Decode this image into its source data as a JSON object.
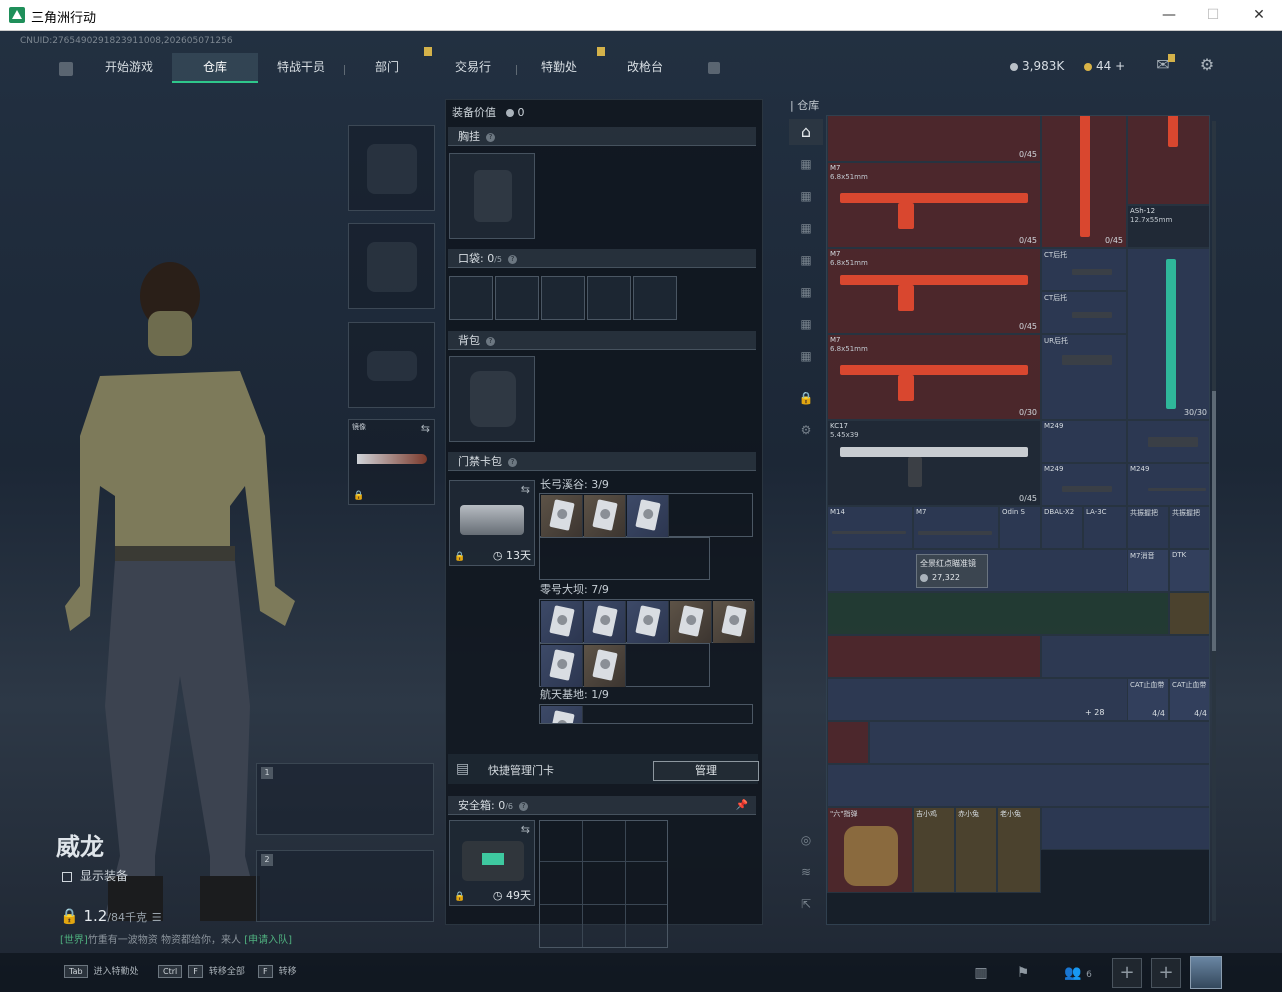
{
  "window": {
    "title": "三角洲行动",
    "min": "—",
    "max": "☐",
    "close": "✕"
  },
  "cnuid": "CNUID:2765490291823911008,202605071256",
  "nav": {
    "tabs": [
      {
        "label": "开始游戏"
      },
      {
        "label": "仓库"
      },
      {
        "label": "特战干员"
      },
      {
        "label": "部门"
      },
      {
        "label": "交易行"
      },
      {
        "label": "特勤处"
      },
      {
        "label": "改枪台"
      }
    ],
    "active_tab": "仓库"
  },
  "currency": {
    "silver": "3,983K",
    "gold": "44",
    "gold_plus": "+"
  },
  "equipment": {
    "value_label": "装备价值",
    "value": "0",
    "chest_rig": "胸挂",
    "pocket_label": "口袋:",
    "pocket_value": "0",
    "pocket_max": "/5",
    "backpack": "背包",
    "keycard_label": "门禁卡包",
    "keycard_days": "13天",
    "maps": [
      {
        "name": "长弓溪谷:",
        "count": "3/9"
      },
      {
        "name": "零号大坝:",
        "count": "7/9"
      },
      {
        "name": "航天基地:",
        "count": "1/9"
      }
    ],
    "quick_manage": "快捷管理门卡",
    "manage_btn": "管理",
    "safebox_label": "安全箱:",
    "safebox_value": "0",
    "safebox_max": "/6",
    "safebox_days": "49天"
  },
  "character": {
    "name": "威龙",
    "show_gear": "显示装备",
    "weight": "1.2",
    "weight_max": "/84千克",
    "knife_label": "镜像",
    "slot1": "1",
    "slot2": "2"
  },
  "chat": {
    "prefix": "[世界]",
    "text": "竹重有一波物资 物资都给你，来人",
    "link": "[申请入队]"
  },
  "warehouse": {
    "title": "仓库",
    "items": {
      "m7a": {
        "name": "M7",
        "sub": "6.8x51mm",
        "count": "0/45"
      },
      "m7b": {
        "name": "M7",
        "sub": "6.8x51mm",
        "count": "0/45"
      },
      "m7c": {
        "name": "M7",
        "sub": "6.8x51mm",
        "count": "0/45"
      },
      "m7d_count": "0/30",
      "ash": {
        "name": "ASh-12",
        "sub": "12.7x55mm",
        "count": "0/45"
      },
      "gun_top_count": "0/45",
      "ctbtn1": "CT后托",
      "ctbtn2": "CT后托",
      "ur": "UR后托",
      "green_count": "30/30",
      "kc17": {
        "name": "KC17",
        "sub": "5.45x39",
        "count": "0/45"
      },
      "m249a": "M249",
      "m249b": "M249",
      "m249c": "M249",
      "m14": "M14",
      "m7e": "M7",
      "odin": "Odin S",
      "dbal": "DBAL-X2",
      "la3c": "LA-3C",
      "grip1": "共振握把",
      "grip2": "共振握把",
      "cat1": "CAT止血带",
      "cat2": "CAT止血带",
      "cat_count": "4/4",
      "cat_count2": "4/4",
      "m7gun": "M7消音",
      "dtk": "DTK",
      "six": "\"六\"指弹",
      "c1": "吉小鸡",
      "c2": "赤小兔",
      "c3": "老小兔"
    },
    "tooltip_name": "全景红点瞄准镜",
    "tooltip_price": "27,322",
    "x28": "+ 28"
  },
  "bottom": {
    "tab_key": "Tab",
    "tab_label": "进入特勤处",
    "ctrl_key": "Ctrl",
    "f_key": "F",
    "ctrlf_label": "转移全部",
    "f2_key": "F",
    "f_label": "转移",
    "friends": "6"
  }
}
